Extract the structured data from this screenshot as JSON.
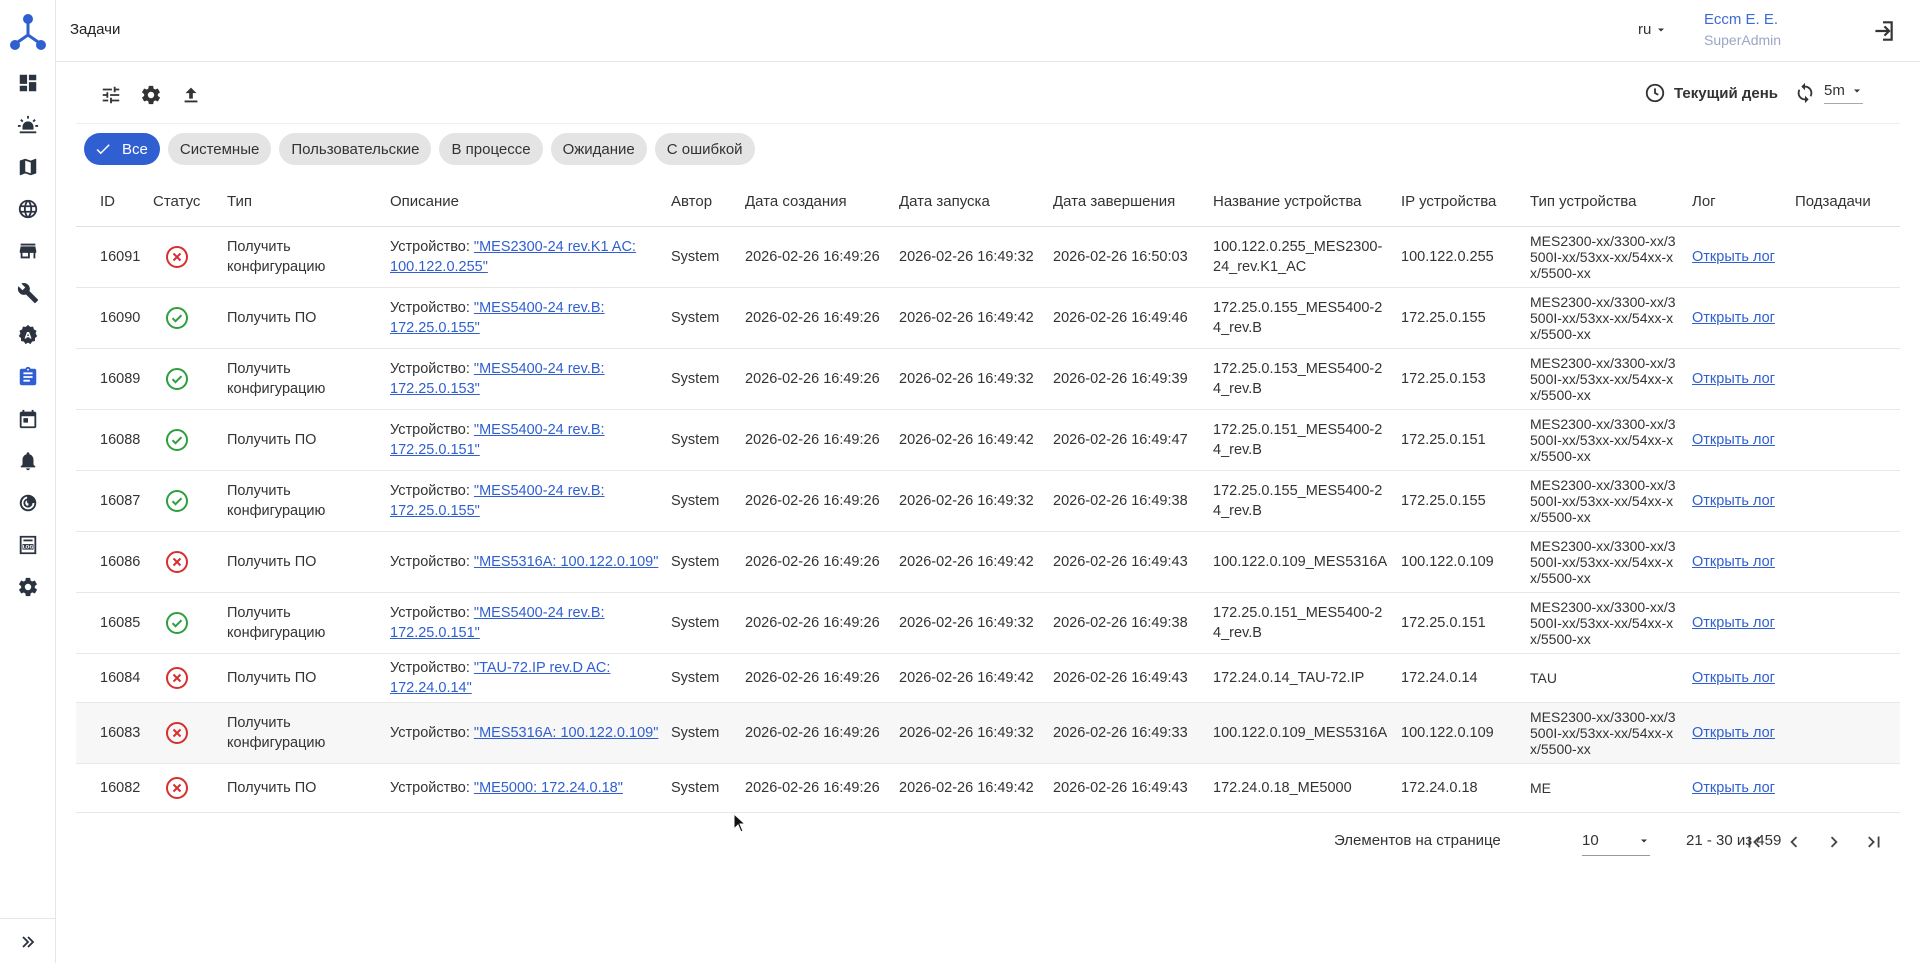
{
  "header": {
    "title": "Задачи",
    "language": "ru",
    "user_name": "Ессm Е. Е.",
    "user_role": "SuperAdmin"
  },
  "toolbar": {
    "period_label": "Текущий день",
    "refresh_interval": "5m"
  },
  "filters": [
    {
      "label": "Все",
      "active": true
    },
    {
      "label": "Системные",
      "active": false
    },
    {
      "label": "Пользовательские",
      "active": false
    },
    {
      "label": "В процессе",
      "active": false
    },
    {
      "label": "Ожидание",
      "active": false
    },
    {
      "label": "С ошибкой",
      "active": false
    }
  ],
  "table": {
    "columns": [
      "ID",
      "Статус",
      "Тип",
      "Описание",
      "Автор",
      "Дата создания",
      "Дата запуска",
      "Дата завершения",
      "Название устройства",
      "IP устройства",
      "Тип устройства",
      "Лог",
      "Подзадачи"
    ],
    "rows": [
      {
        "id": "16091",
        "status": "error",
        "type": "Получить конфигурацию",
        "desc_prefix": "Устройство: ",
        "desc_link": "\"MES2300-24 rev.K1 AC: 100.122.0.255\"",
        "author": "System",
        "created": "2026-02-26 16:49:26",
        "started": "2026-02-26 16:49:32",
        "finished": "2026-02-26 16:50:03",
        "device_name": "100.122.0.255_MES2300-24_rev.K1_AC",
        "ip": "100.122.0.255",
        "device_type": "MES2300-xx/3300-xx/3500I-xx/53xx-xx/54xx-xx/5500-xx",
        "log": "Открыть лог",
        "subtasks": ""
      },
      {
        "id": "16090",
        "status": "ok",
        "type": "Получить ПО",
        "desc_prefix": "Устройство: ",
        "desc_link": "\"MES5400-24 rev.B: 172.25.0.155\"",
        "author": "System",
        "created": "2026-02-26 16:49:26",
        "started": "2026-02-26 16:49:42",
        "finished": "2026-02-26 16:49:46",
        "device_name": "172.25.0.155_MES5400-24_rev.B",
        "ip": "172.25.0.155",
        "device_type": "MES2300-xx/3300-xx/3500I-xx/53xx-xx/54xx-xx/5500-xx",
        "log": "Открыть лог",
        "subtasks": ""
      },
      {
        "id": "16089",
        "status": "ok",
        "type": "Получить конфигурацию",
        "desc_prefix": "Устройство: ",
        "desc_link": "\"MES5400-24 rev.B: 172.25.0.153\"",
        "author": "System",
        "created": "2026-02-26 16:49:26",
        "started": "2026-02-26 16:49:32",
        "finished": "2026-02-26 16:49:39",
        "device_name": "172.25.0.153_MES5400-24_rev.B",
        "ip": "172.25.0.153",
        "device_type": "MES2300-xx/3300-xx/3500I-xx/53xx-xx/54xx-xx/5500-xx",
        "log": "Открыть лог",
        "subtasks": ""
      },
      {
        "id": "16088",
        "status": "ok",
        "type": "Получить ПО",
        "desc_prefix": "Устройство: ",
        "desc_link": "\"MES5400-24 rev.B: 172.25.0.151\"",
        "author": "System",
        "created": "2026-02-26 16:49:26",
        "started": "2026-02-26 16:49:42",
        "finished": "2026-02-26 16:49:47",
        "device_name": "172.25.0.151_MES5400-24_rev.B",
        "ip": "172.25.0.151",
        "device_type": "MES2300-xx/3300-xx/3500I-xx/53xx-xx/54xx-xx/5500-xx",
        "log": "Открыть лог",
        "subtasks": ""
      },
      {
        "id": "16087",
        "status": "ok",
        "type": "Получить конфигурацию",
        "desc_prefix": "Устройство: ",
        "desc_link": "\"MES5400-24 rev.B: 172.25.0.155\"",
        "author": "System",
        "created": "2026-02-26 16:49:26",
        "started": "2026-02-26 16:49:32",
        "finished": "2026-02-26 16:49:38",
        "device_name": "172.25.0.155_MES5400-24_rev.B",
        "ip": "172.25.0.155",
        "device_type": "MES2300-xx/3300-xx/3500I-xx/53xx-xx/54xx-xx/5500-xx",
        "log": "Открыть лог",
        "subtasks": ""
      },
      {
        "id": "16086",
        "status": "error",
        "type": "Получить ПО",
        "desc_prefix": "Устройство: ",
        "desc_link": "\"MES5316A: 100.122.0.109\"",
        "author": "System",
        "created": "2026-02-26 16:49:26",
        "started": "2026-02-26 16:49:42",
        "finished": "2026-02-26 16:49:43",
        "device_name": "100.122.0.109_MES5316A",
        "ip": "100.122.0.109",
        "device_type": "MES2300-xx/3300-xx/3500I-xx/53xx-xx/54xx-xx/5500-xx",
        "log": "Открыть лог",
        "subtasks": ""
      },
      {
        "id": "16085",
        "status": "ok",
        "type": "Получить конфигурацию",
        "desc_prefix": "Устройство: ",
        "desc_link": "\"MES5400-24 rev.B: 172.25.0.151\"",
        "author": "System",
        "created": "2026-02-26 16:49:26",
        "started": "2026-02-26 16:49:32",
        "finished": "2026-02-26 16:49:38",
        "device_name": "172.25.0.151_MES5400-24_rev.B",
        "ip": "172.25.0.151",
        "device_type": "MES2300-xx/3300-xx/3500I-xx/53xx-xx/54xx-xx/5500-xx",
        "log": "Открыть лог",
        "subtasks": ""
      },
      {
        "id": "16084",
        "status": "error",
        "type": "Получить ПО",
        "desc_prefix": "Устройство: ",
        "desc_link": "\"TAU-72.IP rev.D AC: 172.24.0.14\"",
        "author": "System",
        "created": "2026-02-26 16:49:26",
        "started": "2026-02-26 16:49:42",
        "finished": "2026-02-26 16:49:43",
        "device_name": "172.24.0.14_TAU-72.IP",
        "ip": "172.24.0.14",
        "device_type": "TAU",
        "log": "Открыть лог",
        "subtasks": ""
      },
      {
        "id": "16083",
        "status": "error",
        "type": "Получить конфигурацию",
        "desc_prefix": "Устройство: ",
        "desc_link": "\"MES5316A: 100.122.0.109\"",
        "author": "System",
        "created": "2026-02-26 16:49:26",
        "started": "2026-02-26 16:49:32",
        "finished": "2026-02-26 16:49:33",
        "device_name": "100.122.0.109_MES5316A",
        "ip": "100.122.0.109",
        "device_type": "MES2300-xx/3300-xx/3500I-xx/53xx-xx/54xx-xx/5500-xx",
        "log": "Открыть лог",
        "subtasks": ""
      },
      {
        "id": "16082",
        "status": "error",
        "type": "Получить ПО",
        "desc_prefix": "Устройство: ",
        "desc_link": "\"ME5000: 172.24.0.18\"",
        "author": "System",
        "created": "2026-02-26 16:49:26",
        "started": "2026-02-26 16:49:42",
        "finished": "2026-02-26 16:49:43",
        "device_name": "172.24.0.18_ME5000",
        "ip": "172.24.0.18",
        "device_type": "ME",
        "log": "Открыть лог",
        "subtasks": ""
      }
    ]
  },
  "pagination": {
    "items_per_page_label": "Элементов на странице",
    "items_per_page": "10",
    "range": "21 - 30 из 459"
  },
  "colors": {
    "accent": "#2f5fd0",
    "ok": "#2e9e3e",
    "error": "#d62f2f"
  }
}
